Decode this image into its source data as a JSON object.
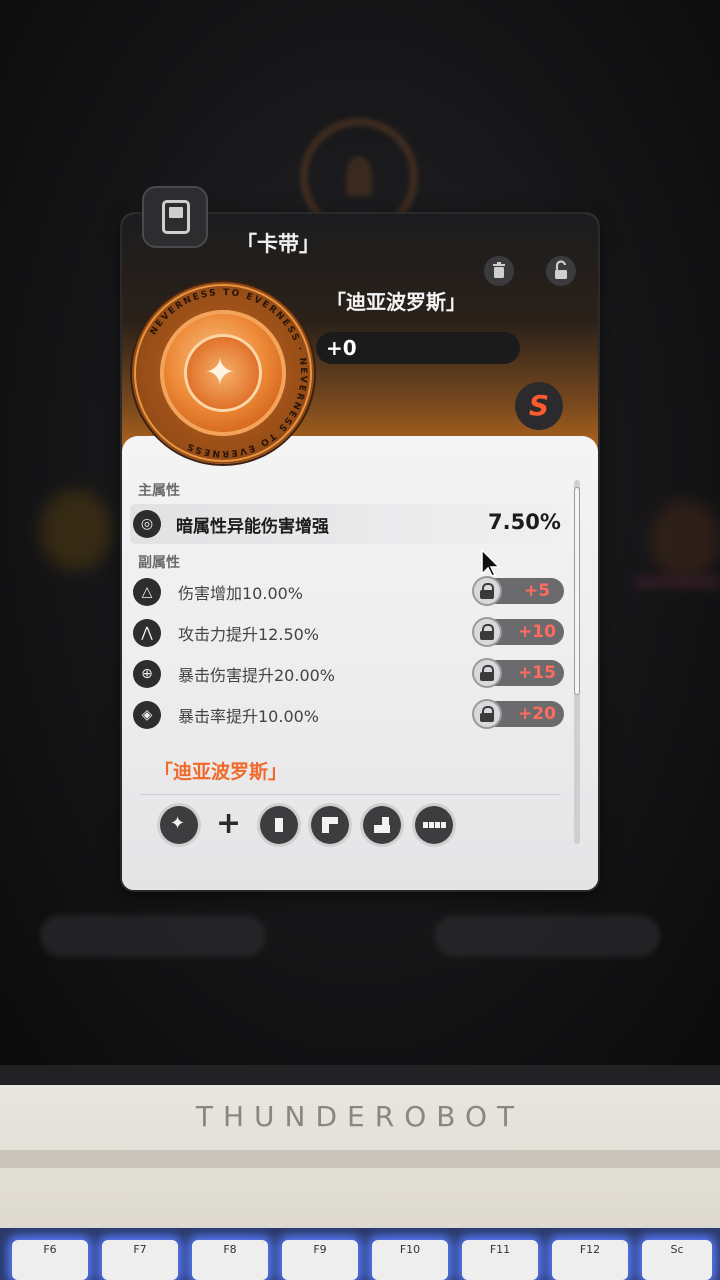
{
  "slot": {
    "title": "「卡带」"
  },
  "disc": {
    "ring_text": "NEVERNESS TO EVERNESS"
  },
  "item": {
    "name": "「迪亚波罗斯」",
    "level": "+0"
  },
  "main_stat": {
    "section_label": "主属性",
    "name": "暗属性异能伤害增强",
    "value": "7.50%"
  },
  "sub_stats": {
    "section_label": "副属性",
    "items": [
      {
        "name": "伤害增加10.00%",
        "bonus": "+5"
      },
      {
        "name": "攻击力提升12.50%",
        "bonus": "+10"
      },
      {
        "name": "暴击伤害提升20.00%",
        "bonus": "+15"
      },
      {
        "name": "暴击率提升10.00%",
        "bonus": "+20"
      }
    ]
  },
  "set": {
    "name": "「迪亚波罗斯」",
    "plus": "+"
  },
  "laptop": {
    "brand": "THUNDEROBOT",
    "keys": [
      "F6",
      "F7",
      "F8",
      "F9",
      "F10",
      "F11",
      "F12",
      "Sc"
    ]
  },
  "colors": {
    "accent_orange": "#f06a2c",
    "bonus_red": "#ff6b5e",
    "panel_bg": "#ebebec"
  }
}
